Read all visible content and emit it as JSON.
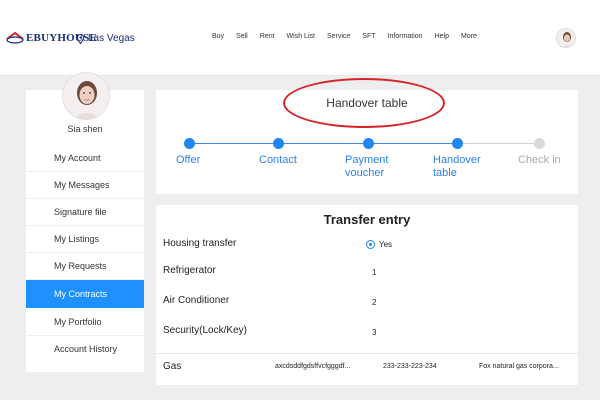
{
  "header": {
    "logo_text": "EBUYHOUSE",
    "location": "Las Vegas",
    "nav": [
      "Buy",
      "Sell",
      "Rent",
      "Wish List",
      "Service",
      "SFT",
      "Information",
      "Help",
      "More"
    ]
  },
  "sidebar": {
    "user_name": "Sia shen",
    "items": [
      {
        "label": "My Account"
      },
      {
        "label": "My Messages"
      },
      {
        "label": "Signature file"
      },
      {
        "label": "My Listings"
      },
      {
        "label": "My Requests"
      },
      {
        "label": "My Contracts",
        "active": true
      },
      {
        "label": "My Portfolio"
      },
      {
        "label": "Account History"
      }
    ]
  },
  "handover": {
    "title": "Handover table",
    "steps": [
      {
        "label": "Offer",
        "done": true
      },
      {
        "label": "Contact",
        "done": true
      },
      {
        "label": "Payment\nvoucher",
        "done": true
      },
      {
        "label": "Handover\ntable",
        "done": true
      },
      {
        "label": "Check in",
        "done": false
      }
    ]
  },
  "transfer": {
    "title": "Transfer entry",
    "housing_transfer_label": "Housing transfer",
    "housing_transfer_value": "Yes",
    "rows": [
      {
        "label": "Refrigerator",
        "value": "1"
      },
      {
        "label": "Air Conditioner",
        "value": "2"
      },
      {
        "label": "Security(Lock/Key)",
        "value": "3"
      }
    ],
    "gas": {
      "label": "Gas",
      "account": "axcdsddfgdsffvcfgggdf...",
      "phone": "233-233-223-234",
      "provider": "Fox natural gas corpora..."
    }
  },
  "colors": {
    "accent": "#1e90ff",
    "brand_navy": "#1a2d7a",
    "annotation_red": "#d4242a",
    "inactive_grey": "#d9d9d9"
  }
}
